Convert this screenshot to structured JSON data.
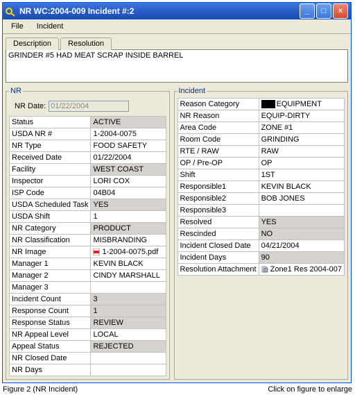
{
  "window": {
    "title": "NR   WC:2004-009   Incident #:2"
  },
  "menu": {
    "file": "File",
    "incident": "Incident"
  },
  "tabs": {
    "description": "Description",
    "resolution": "Resolution"
  },
  "description_text": "GRINDER #5 HAD MEAT SCRAP INSIDE BARREL",
  "nr": {
    "legend": "NR",
    "date_label": "NR Date:",
    "date_value": "01/22/2004",
    "rows": [
      {
        "label": "Status",
        "value": "ACTIVE",
        "s": true
      },
      {
        "label": "USDA NR #",
        "value": "1-2004-0075"
      },
      {
        "label": "NR Type",
        "value": "FOOD SAFETY"
      },
      {
        "label": "Received Date",
        "value": "01/22/2004"
      },
      {
        "label": "Facility",
        "value": "WEST COAST",
        "s": true
      },
      {
        "label": "Inspector",
        "value": "LORI COX"
      },
      {
        "label": "ISP Code",
        "value": "04B04"
      },
      {
        "label": "USDA Scheduled Task",
        "value": "YES",
        "s": true
      },
      {
        "label": "USDA Shift",
        "value": "1"
      },
      {
        "label": "NR Category",
        "value": "PRODUCT",
        "s": true
      },
      {
        "label": "NR Classification",
        "value": "MISBRANDING"
      },
      {
        "label": "NR Image",
        "value": "1-2004-0075.pdf",
        "icon": "pdf"
      },
      {
        "label": "Manager 1",
        "value": "KEVIN BLACK"
      },
      {
        "label": "Manager 2",
        "value": "CINDY MARSHALL"
      },
      {
        "label": "Manager 3",
        "value": ""
      },
      {
        "label": "Incident Count",
        "value": "3",
        "s": true
      },
      {
        "label": "Response Count",
        "value": "1",
        "s": true
      },
      {
        "label": "Response Status",
        "value": "REVIEW",
        "s": true
      },
      {
        "label": "NR Appeal Level",
        "value": "LOCAL"
      },
      {
        "label": "Appeal Status",
        "value": "REJECTED",
        "s": true
      },
      {
        "label": "NR Closed Date",
        "value": ""
      },
      {
        "label": "NR Days",
        "value": ""
      }
    ]
  },
  "incident": {
    "legend": "Incident",
    "rows": [
      {
        "label": "Reason Category",
        "value": "EQUIPMENT",
        "black": true
      },
      {
        "label": "NR Reason",
        "value": "EQUIP-DIRTY"
      },
      {
        "label": "Area Code",
        "value": "ZONE #1"
      },
      {
        "label": "Room Code",
        "value": "GRINDING"
      },
      {
        "label": "RTE / RAW",
        "value": "RAW"
      },
      {
        "label": "OP / Pre-OP",
        "value": "OP"
      },
      {
        "label": "Shift",
        "value": "1ST"
      },
      {
        "label": "Responsible1",
        "value": "KEVIN BLACK"
      },
      {
        "label": "Responsible2",
        "value": "BOB JONES"
      },
      {
        "label": "Responsible3",
        "value": ""
      },
      {
        "label": "Resolved",
        "value": "YES",
        "s": true
      },
      {
        "label": "Rescinded",
        "value": "NO",
        "s": true
      },
      {
        "label": "Incident Closed Date",
        "value": "04/21/2004"
      },
      {
        "label": "Incident Days",
        "value": "90",
        "s": true
      },
      {
        "label": "Resolution Attachment",
        "value": "Zone1 Res 2004-007",
        "icon": "attach"
      }
    ]
  },
  "caption": {
    "left": "Figure 2 (NR Incident)",
    "right": "Click on figure to enlarge"
  }
}
